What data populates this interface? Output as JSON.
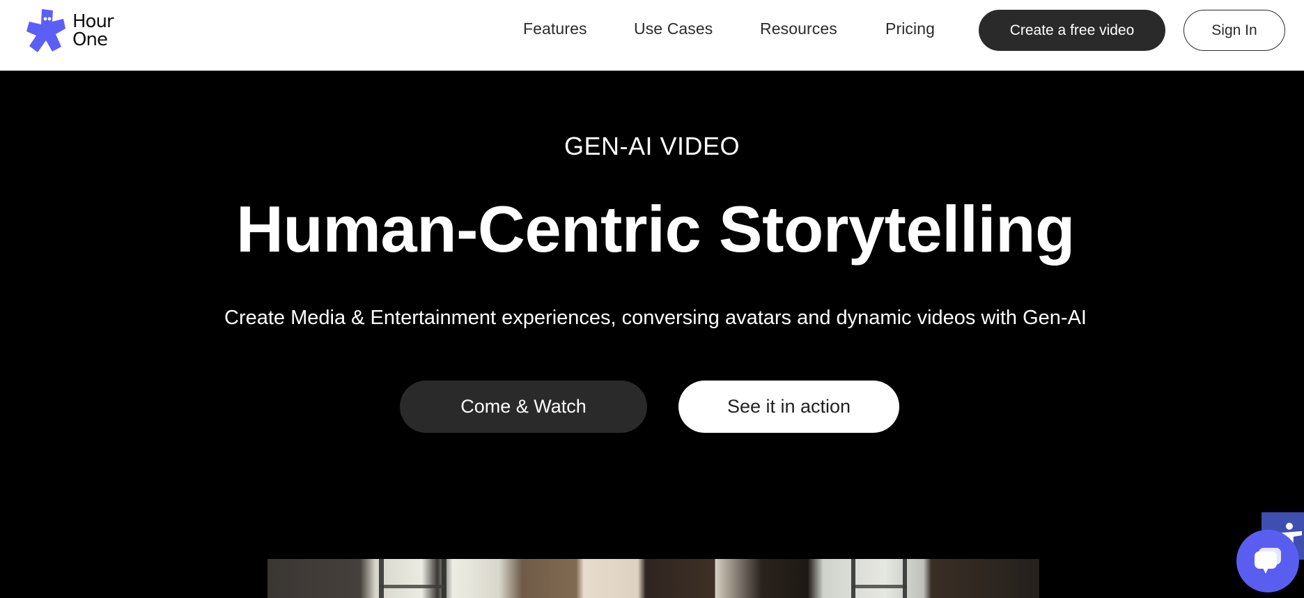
{
  "header": {
    "brand": {
      "line1": "Hour",
      "line2": "One",
      "color": "#5b5ef7"
    },
    "nav": [
      {
        "label": "Features"
      },
      {
        "label": "Use Cases"
      },
      {
        "label": "Resources"
      },
      {
        "label": "Pricing"
      }
    ],
    "cta_label": "Create a free video",
    "signin_label": "Sign In"
  },
  "hero": {
    "eyebrow": "GEN-AI VIDEO",
    "headline": "Human-Centric Storytelling",
    "subhead": "Create Media & Entertainment experiences, conversing avatars and dynamic videos with Gen-AI",
    "primary_button": "Come & Watch",
    "secondary_button": "See it in action"
  },
  "widgets": {
    "accessibility_icon": "accessibility-person-icon",
    "chat_icon": "chat-bubbles-icon",
    "chat_color": "#5a5ef0",
    "accessibility_color": "#3f4fb0"
  }
}
